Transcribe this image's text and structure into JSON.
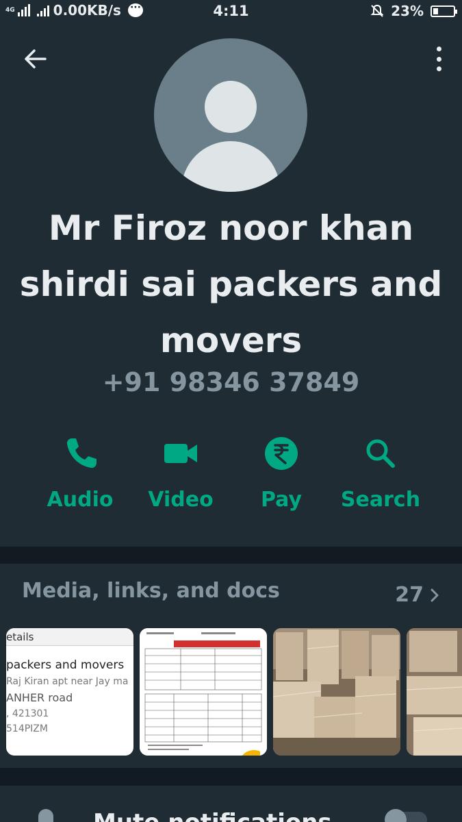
{
  "status_bar": {
    "network": "4G",
    "speed": "0.00KB/s",
    "time": "4:11",
    "battery": "23%"
  },
  "contact": {
    "name": "Mr Firoz noor khan shirdi sai packers and movers",
    "phone": "+91 98346 37849"
  },
  "actions": [
    {
      "label": "Audio",
      "icon": "phone-icon"
    },
    {
      "label": "Video",
      "icon": "video-icon"
    },
    {
      "label": "Pay",
      "icon": "rupee-icon"
    },
    {
      "label": "Search",
      "icon": "search-icon"
    }
  ],
  "media": {
    "title": "Media, links, and docs",
    "count": "27",
    "thumb1": {
      "header": "etails",
      "business": "packers and movers",
      "line1": "Raj Kiran apt near Jay ma",
      "line2": "ANHER road",
      "line3": ", 421301",
      "line4": "514PIZM"
    }
  },
  "settings": {
    "mute_label": "Mute notifications"
  },
  "colors": {
    "background": "#121b22",
    "panel": "#1f2c34",
    "accent": "#00a884",
    "muted_text": "#8696a0"
  }
}
